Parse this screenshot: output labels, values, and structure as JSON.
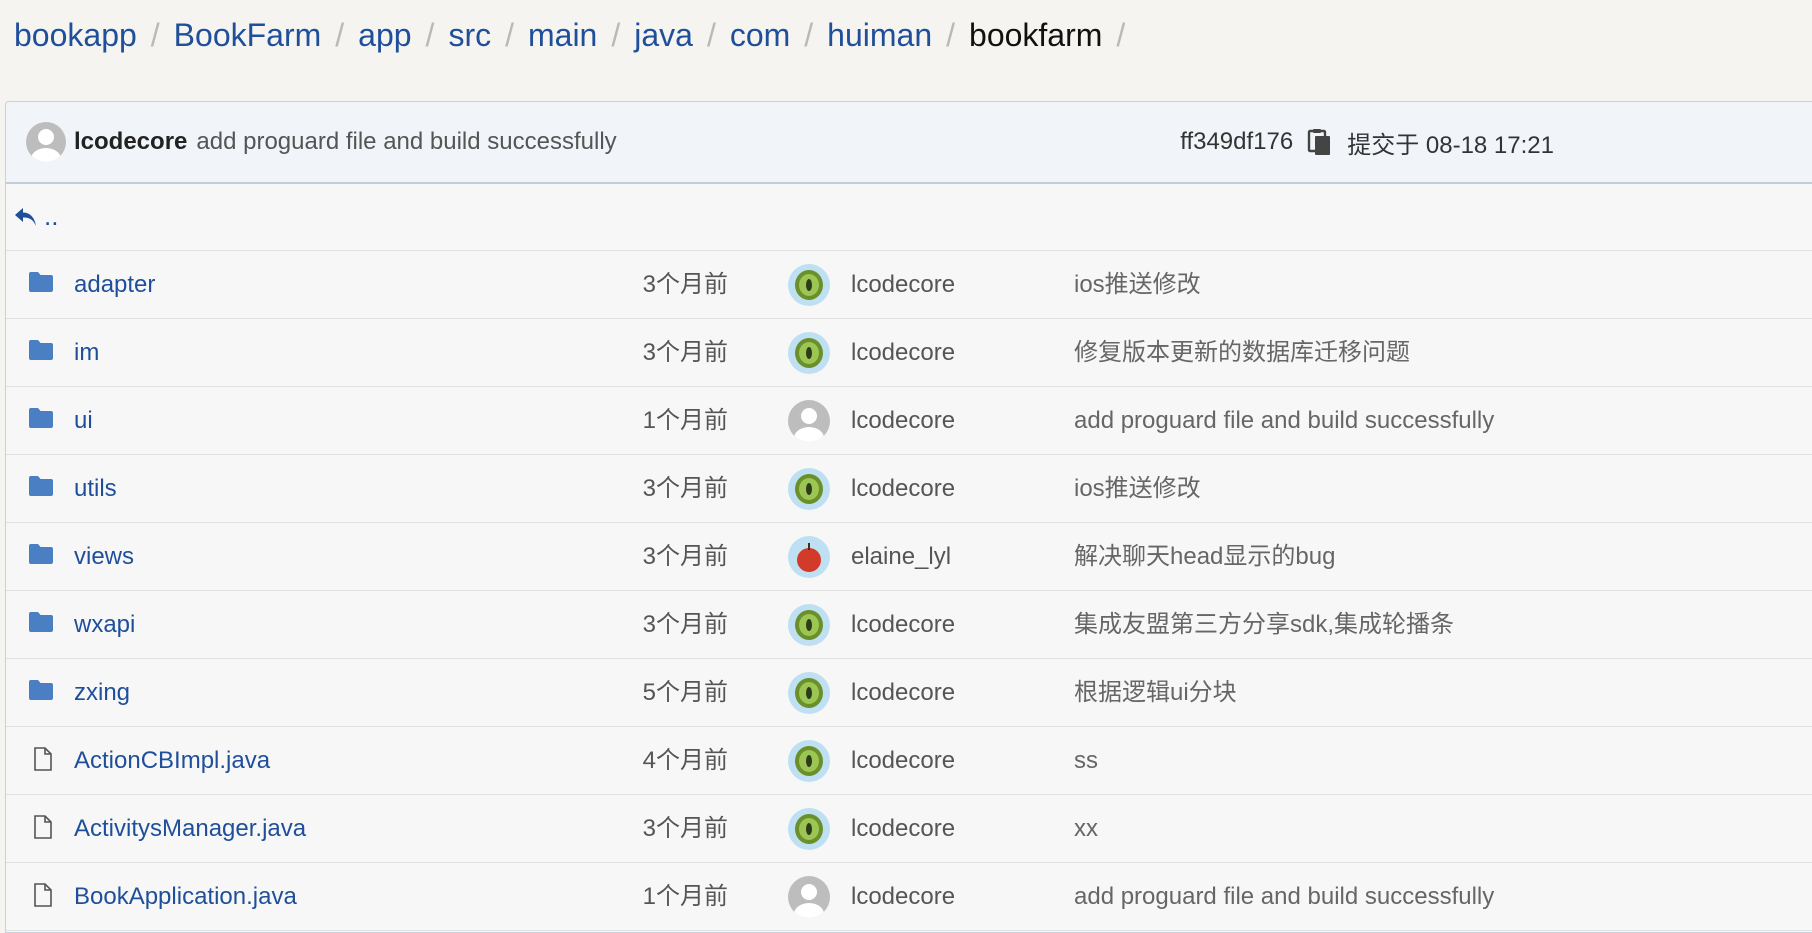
{
  "breadcrumb": {
    "items": [
      "bookapp",
      "BookFarm",
      "app",
      "src",
      "main",
      "java",
      "com",
      "huiman"
    ],
    "current": "bookfarm",
    "separator": "/"
  },
  "last_commit": {
    "author": "lcodecore",
    "message": "add proguard file and build successfully",
    "hash": "ff349df176",
    "time": "提交于 08-18 17:21"
  },
  "parent_dir_label": "..",
  "files": [
    {
      "type": "folder",
      "name": "adapter",
      "time": "3个月前",
      "avatar": "kiwi",
      "author": "lcodecore",
      "commit": "ios推送修改"
    },
    {
      "type": "folder",
      "name": "im",
      "time": "3个月前",
      "avatar": "kiwi",
      "author": "lcodecore",
      "commit": "修复版本更新的数据库迁移问题"
    },
    {
      "type": "folder",
      "name": "ui",
      "time": "1个月前",
      "avatar": "default",
      "author": "lcodecore",
      "commit": "add proguard file and build successfully"
    },
    {
      "type": "folder",
      "name": "utils",
      "time": "3个月前",
      "avatar": "kiwi",
      "author": "lcodecore",
      "commit": "ios推送修改"
    },
    {
      "type": "folder",
      "name": "views",
      "time": "3个月前",
      "avatar": "apple",
      "author": "elaine_lyl",
      "commit": "解决聊天head显示的bug"
    },
    {
      "type": "folder",
      "name": "wxapi",
      "time": "3个月前",
      "avatar": "kiwi",
      "author": "lcodecore",
      "commit": "集成友盟第三方分享sdk,集成轮播条"
    },
    {
      "type": "folder",
      "name": "zxing",
      "time": "5个月前",
      "avatar": "kiwi",
      "author": "lcodecore",
      "commit": "根据逻辑ui分块"
    },
    {
      "type": "file",
      "name": "ActionCBImpl.java",
      "time": "4个月前",
      "avatar": "kiwi",
      "author": "lcodecore",
      "commit": "ss"
    },
    {
      "type": "file",
      "name": "ActivitysManager.java",
      "time": "3个月前",
      "avatar": "kiwi",
      "author": "lcodecore",
      "commit": "xx"
    },
    {
      "type": "file",
      "name": "BookApplication.java",
      "time": "1个月前",
      "avatar": "default",
      "author": "lcodecore",
      "commit": "add proguard file and build successfully"
    }
  ],
  "colors": {
    "link": "#1f4f9a",
    "folder_icon": "#4a7fc4",
    "background": "#f5f4f0"
  },
  "icons": {
    "folder": "folder-icon",
    "file": "file-icon",
    "up": "reply-arrow-icon",
    "copy": "copy-icon"
  }
}
